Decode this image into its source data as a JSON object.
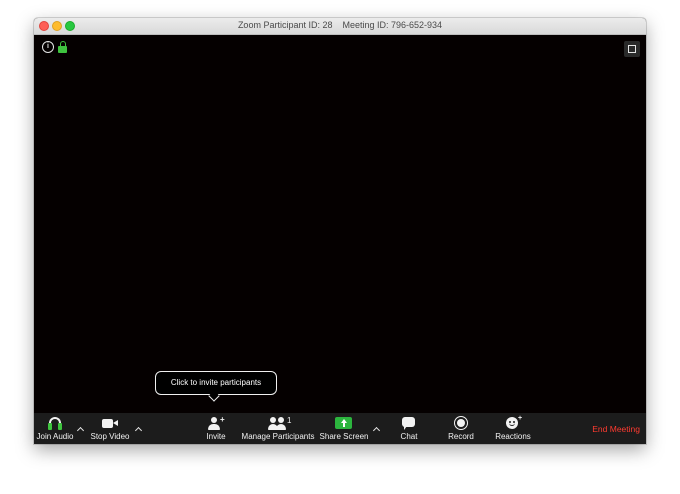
{
  "window": {
    "title": "Zoom Participant ID: 28    Meeting ID: 796-652-934"
  },
  "tooltip": {
    "text": "Click to invite participants"
  },
  "toolbar": {
    "join_audio": "Join Audio",
    "stop_video": "Stop Video",
    "invite": "Invite",
    "manage_participants": "Manage Participants",
    "participant_count": "1",
    "share_screen": "Share Screen",
    "chat": "Chat",
    "record": "Record",
    "reactions": "Reactions",
    "end_meeting": "End Meeting"
  },
  "colors": {
    "end_meeting": "#ff3b30",
    "share_screen": "#2cb53e",
    "encryption_lock": "#3fc33f",
    "toolbar_bg": "#1c1c1c"
  },
  "icons": {
    "info": "info-icon",
    "lock": "lock-icon",
    "fullscreen": "fullscreen-icon",
    "audio": "headphone-icon",
    "video": "camera-icon",
    "invite": "invite-icon",
    "participants": "participants-icon",
    "share": "share-screen-icon",
    "chat": "chat-icon",
    "record": "record-icon",
    "reactions": "reaction-icon"
  }
}
